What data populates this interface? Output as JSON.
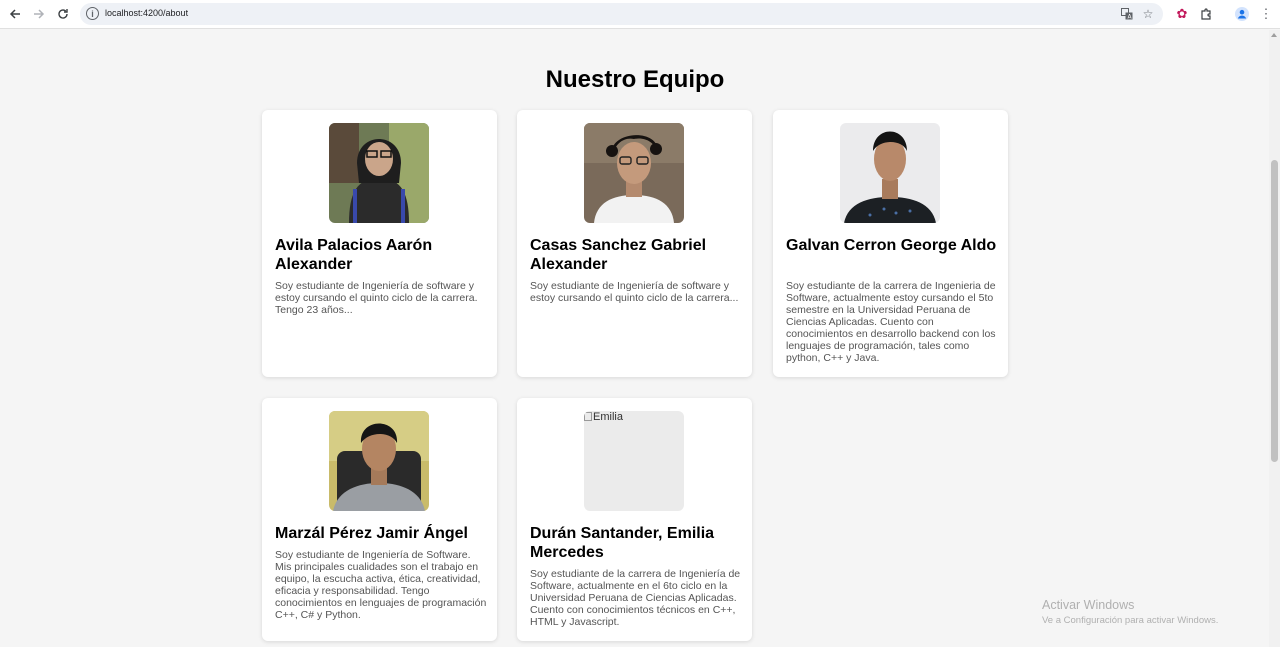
{
  "browser": {
    "url": "localhost:4200/about",
    "icons": {
      "back": "arrow-left-icon",
      "forward": "arrow-right-icon",
      "reload": "reload-icon",
      "info": "info-icon",
      "translate": "translate-icon",
      "bookmark": "star-icon",
      "extension_app": "extension-logo-icon",
      "extensions": "puzzle-icon",
      "profile": "profile-icon",
      "menu": "kebab-menu-icon"
    }
  },
  "page": {
    "title": "Nuestro Equipo"
  },
  "team": [
    {
      "name": "Avila Palacios Aarón Alexander",
      "description": "Soy estudiante de Ingeniería de software y estoy cursando el quinto ciclo de la carrera. Tengo 23 años...",
      "photo_alt": "",
      "photo_broken": false
    },
    {
      "name": "Casas Sanchez Gabriel Alexander",
      "description": "Soy estudiante de Ingeniería de software y estoy cursando el quinto ciclo de la carrera...",
      "photo_alt": "",
      "photo_broken": false
    },
    {
      "name": "Galvan Cerron George Aldo",
      "description": "Soy estudiante de la carrera de Ingenieria de Software, actualmente estoy cursando el 5to semestre en la Universidad Peruana de Ciencias Aplicadas. Cuento con conocimientos en desarrollo backend con los lenguajes de programación, tales como python, C++ y Java.",
      "photo_alt": "",
      "photo_broken": false
    },
    {
      "name": "Marzál Pérez Jamir Ángel",
      "description": "Soy estudiante de Ingeniería de Software. Mis principales cualidades son el trabajo en equipo, la escucha activa, ética, creatividad, eficacia y responsabilidad. Tengo conocimientos en lenguajes de programación C++, C# y Python.",
      "photo_alt": "",
      "photo_broken": false
    },
    {
      "name": "Durán Santander, Emilia Mercedes",
      "description": "Soy estudiante de la carrera de Ingeniería de Software, actualmente en el 6to ciclo en la Universidad Peruana de Ciencias Aplicadas. Cuento con conocimientos técnicos en C++, HTML y Javascript.",
      "photo_alt": "Emilia",
      "photo_broken": true
    }
  ],
  "watermark": {
    "title": "Activar Windows",
    "subtitle": "Ve a Configuración para activar Windows."
  }
}
